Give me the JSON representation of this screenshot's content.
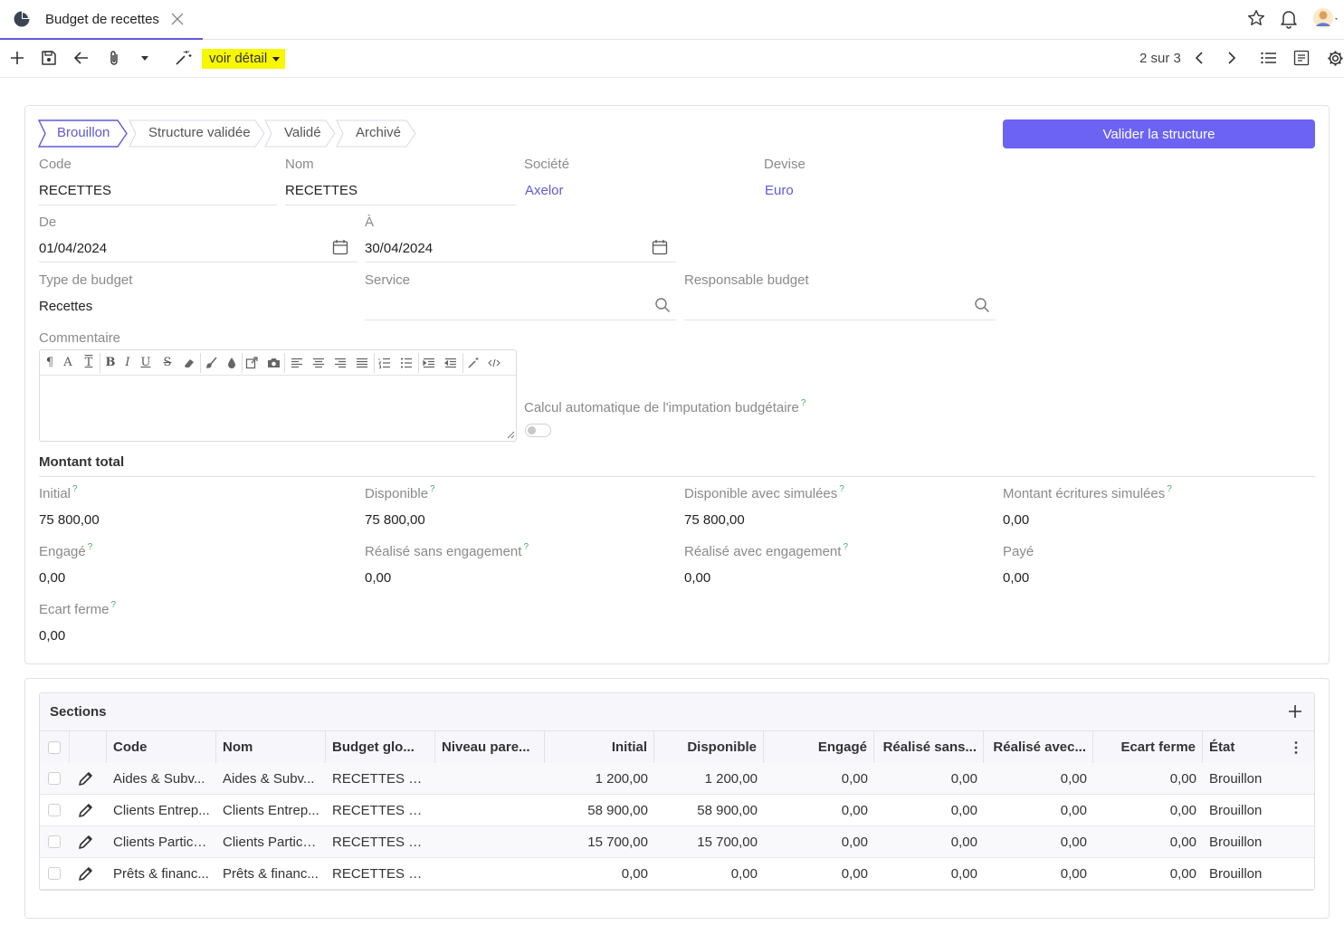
{
  "tab": {
    "title": "Budget de recettes"
  },
  "toolbar": {
    "voir_detail": "voir détail",
    "pager": "2 sur 3"
  },
  "status_steps": [
    {
      "label": "Brouillon",
      "active": true
    },
    {
      "label": "Structure validée",
      "active": false
    },
    {
      "label": "Validé",
      "active": false
    },
    {
      "label": "Archivé",
      "active": false
    }
  ],
  "validate_button": "Valider la structure",
  "form": {
    "code": {
      "label": "Code",
      "value": "RECETTES"
    },
    "nom": {
      "label": "Nom",
      "value": "RECETTES"
    },
    "societe": {
      "label": "Société",
      "value": "Axelor"
    },
    "devise": {
      "label": "Devise",
      "value": "Euro"
    },
    "de": {
      "label": "De",
      "value": "01/04/2024"
    },
    "a": {
      "label": "À",
      "value": "30/04/2024"
    },
    "type_budget": {
      "label": "Type de budget",
      "value": "Recettes"
    },
    "service": {
      "label": "Service",
      "value": ""
    },
    "responsable": {
      "label": "Responsable budget",
      "value": ""
    },
    "commentaire": {
      "label": "Commentaire"
    },
    "calcul_auto": {
      "label": "Calcul automatique de l'imputation budgétaire",
      "help": "?",
      "enabled": false
    }
  },
  "montant_total": {
    "title": "Montant total",
    "fields": [
      {
        "label": "Initial",
        "help": "?",
        "value": "75 800,00"
      },
      {
        "label": "Disponible",
        "help": "?",
        "value": "75 800,00"
      },
      {
        "label": "Disponible avec simulées",
        "help": "?",
        "value": "75 800,00"
      },
      {
        "label": "Montant écritures simulées",
        "help": "?",
        "value": "0,00"
      },
      {
        "label": "Engagé",
        "help": "?",
        "value": "0,00"
      },
      {
        "label": "Réalisé sans engagement",
        "help": "?",
        "value": "0,00"
      },
      {
        "label": "Réalisé avec engagement",
        "help": "?",
        "value": "0,00"
      },
      {
        "label": "Payé",
        "help": "",
        "value": "0,00"
      },
      {
        "label": "Ecart ferme",
        "help": "?",
        "value": "0,00"
      }
    ]
  },
  "sections": {
    "title": "Sections",
    "columns": [
      "Code",
      "Nom",
      "Budget glo...",
      "Niveau pare...",
      "Initial",
      "Disponible",
      "Engagé",
      "Réalisé sans...",
      "Réalisé avec...",
      "Ecart ferme",
      "État"
    ],
    "rows": [
      [
        "Aides & Subv...",
        "Aides & Subv...",
        "RECETTES REC...",
        "",
        "1 200,00",
        "1 200,00",
        "0,00",
        "0,00",
        "0,00",
        "0,00",
        "Brouillon"
      ],
      [
        "Clients Entrep...",
        "Clients Entrep...",
        "RECETTES REC...",
        "",
        "58 900,00",
        "58 900,00",
        "0,00",
        "0,00",
        "0,00",
        "0,00",
        "Brouillon"
      ],
      [
        "Clients Particu...",
        "Clients Particu...",
        "RECETTES REC...",
        "",
        "15 700,00",
        "15 700,00",
        "0,00",
        "0,00",
        "0,00",
        "0,00",
        "Brouillon"
      ],
      [
        "Prêts & financ...",
        "Prêts & financ...",
        "RECETTES REC...",
        "",
        "0,00",
        "0,00",
        "0,00",
        "0,00",
        "0,00",
        "0,00",
        "Brouillon"
      ]
    ]
  },
  "colors": {
    "accent": "#6c63f5",
    "link": "#5f5ad8",
    "highlight": "#f7f700",
    "help": "#3fb06b"
  }
}
